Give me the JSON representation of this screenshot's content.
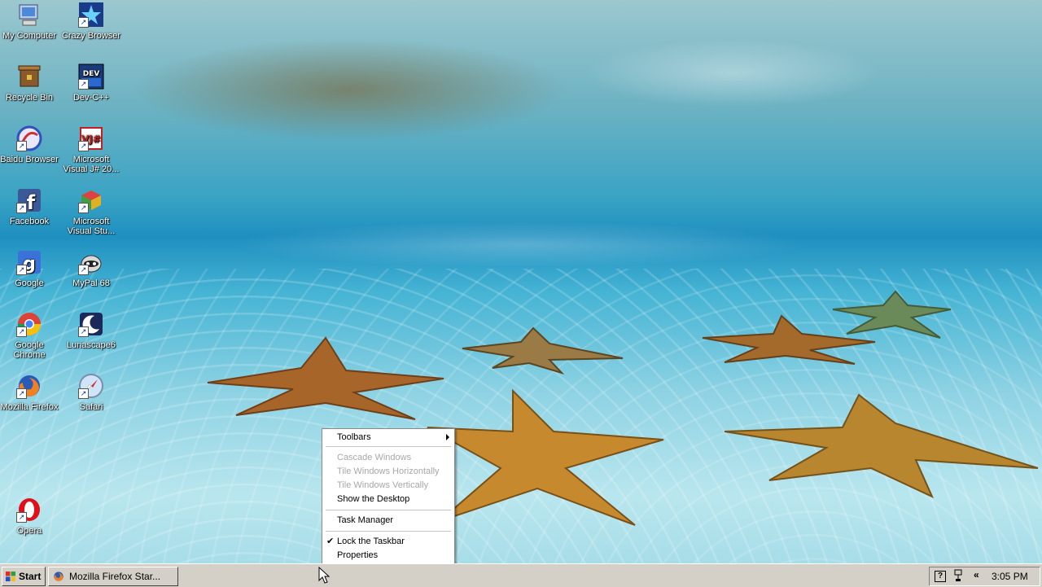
{
  "desktop_icons": [
    {
      "label": "My Computer",
      "icon": "my-computer-icon"
    },
    {
      "label": "Crazy Browser",
      "icon": "crazy-browser-icon"
    },
    {
      "label": "Recycle Bin",
      "icon": "recycle-bin-icon"
    },
    {
      "label": "Dev-C++",
      "icon": "dev-cpp-icon"
    },
    {
      "label": "Baidu Browser",
      "icon": "baidu-browser-icon"
    },
    {
      "label": "Microsoft Visual J# 20...",
      "icon": "visual-jsharp-icon"
    },
    {
      "label": "Facebook",
      "icon": "facebook-icon"
    },
    {
      "label": "Microsoft Visual Stu...",
      "icon": "visual-studio-icon"
    },
    {
      "label": "Google",
      "icon": "google-icon"
    },
    {
      "label": "MyPal 68",
      "icon": "mypal-icon"
    },
    {
      "label": "Google Chrome",
      "icon": "chrome-icon"
    },
    {
      "label": "Lunascape6",
      "icon": "lunascape-icon"
    },
    {
      "label": "Mozilla Firefox",
      "icon": "firefox-icon"
    },
    {
      "label": "Safari",
      "icon": "safari-icon"
    },
    {
      "label": "Opera",
      "icon": "opera-icon"
    }
  ],
  "context_menu": {
    "toolbars": "Toolbars",
    "cascade": "Cascade Windows",
    "tile_h": "Tile Windows Horizontally",
    "tile_v": "Tile Windows Vertically",
    "show_desktop": "Show the Desktop",
    "task_manager": "Task Manager",
    "check_mark": "✔",
    "lock_taskbar": "Lock the Taskbar",
    "properties": "Properties"
  },
  "taskbar": {
    "start_label": "Start",
    "window_button": "Mozilla Firefox Star...",
    "tray_help": "?",
    "tray_chevron": "«",
    "clock": "3:05 PM"
  },
  "colors": {
    "taskbar": "#d4d0c8",
    "disabled_text": "#a7a7a7"
  }
}
